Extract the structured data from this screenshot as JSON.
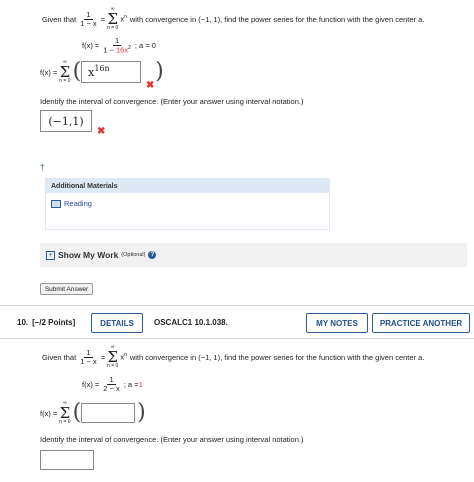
{
  "q1": {
    "given_that": "Given that",
    "frac_num": "1",
    "frac_den": "1 − x",
    "equals": "=",
    "sigma_top": "∞",
    "sigma_bottom": "n = 0",
    "power_text": "x",
    "power_exp": "n",
    "rest": "with convergence in (−1, 1), find the power series for the function with the given center a.",
    "fx_label": "f(x) =",
    "fx_num": "1",
    "fx_den_prefix": "1 − ",
    "fx_den_red": "16x",
    "fx_den_exp": "2",
    "center_text": "; a = 0",
    "sum_label": "f(x) =",
    "answer_base": "x",
    "answer_exp": "16n",
    "identify_text": "Identify the interval of convergence. (Enter your answer using interval notation.)",
    "interval_answer": "(−1,1)",
    "dagger": "†",
    "additional_materials": "Additional Materials",
    "reading_link": "Reading",
    "show_my_work": "Show My Work",
    "optional": "(Optional)",
    "submit": "Submit Answer"
  },
  "q10": {
    "number": "10.",
    "points": "[–/2 Points]",
    "details": "DETAILS",
    "code": "OSCALC1 10.1.038.",
    "my_notes": "MY NOTES",
    "practice": "PRACTICE ANOTHER",
    "given_that": "Given that",
    "frac_num": "1",
    "frac_den": "1 − x",
    "equals": "=",
    "sigma_top": "∞",
    "sigma_bottom": "n = 0",
    "power_text": "x",
    "power_exp": "n",
    "rest": "with convergence in (−1, 1), find the power series for the function with the given center a.",
    "fx_label": "f(x) =",
    "fx_num": "1",
    "fx_den_prefix": "2 − x",
    "center_text": "; a = ",
    "center_red": "1",
    "sum_label": "f(x) =",
    "identify_text": "Identify the interval of convergence. (Enter your answer using interval notation.)"
  },
  "colors": {
    "accent": "#1f4f8a",
    "error": "#e53935",
    "panel_blue": "#dfe8f5",
    "panel_gray": "#f1f1f1"
  }
}
